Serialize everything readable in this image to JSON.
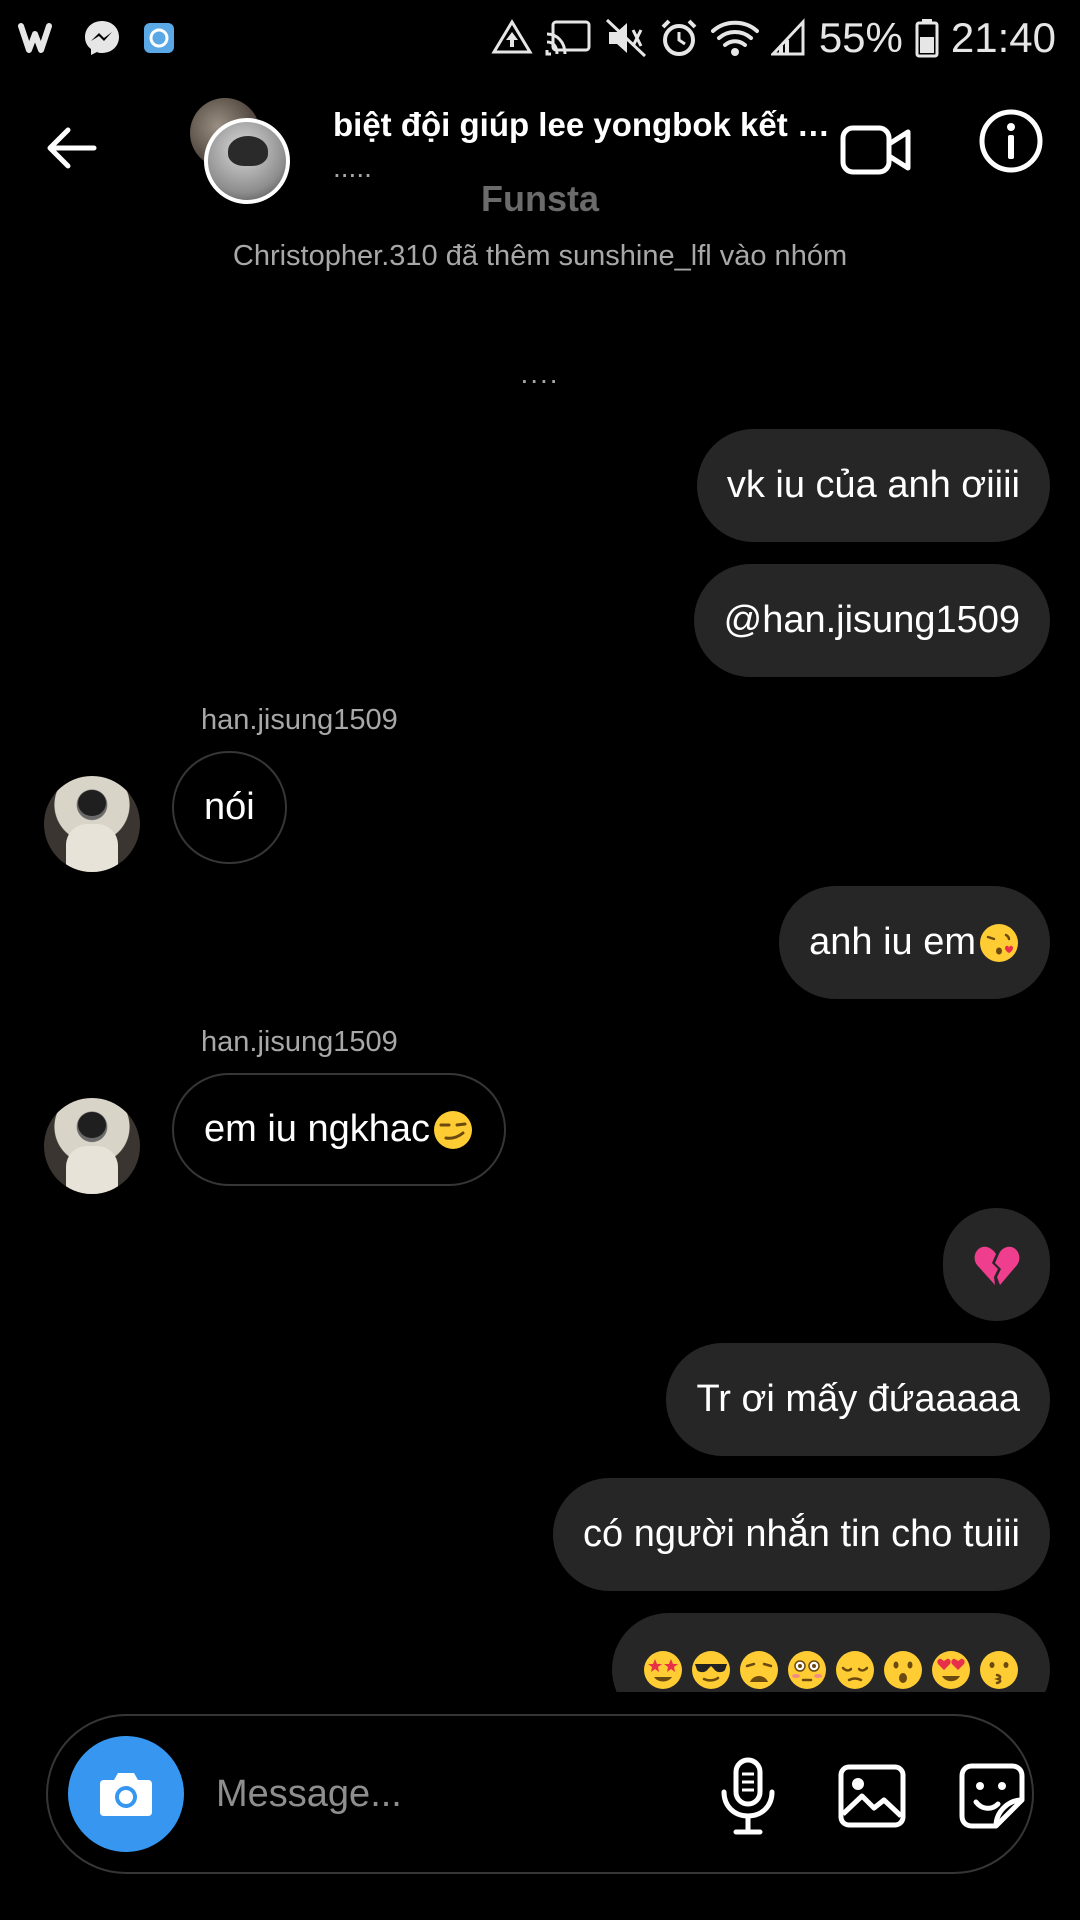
{
  "status_bar": {
    "battery_percent": "55%",
    "time": "21:40"
  },
  "header": {
    "title": "biệt đội giúp lee yongbok kết …",
    "subtitle": "....."
  },
  "banner": "Funsta",
  "system_message": "Christopher.310 đã thêm sunshine_lfl vào nhóm",
  "dots_message": "....",
  "messages": [
    {
      "text": "vk iu của anh ơiiii"
    },
    {
      "text": "@han.jisung1509"
    },
    {
      "sender": "han.jisung1509",
      "text": "nói"
    },
    {
      "text": "anh iu em"
    },
    {
      "sender": "han.jisung1509",
      "text": "em iu ngkhac"
    },
    {
      "emoji": "broken-heart"
    },
    {
      "text": "Tr ơi mấy đứaaaaa"
    },
    {
      "text": "có người nhắn tin cho tuiii"
    },
    {
      "emojis": [
        "star-struck",
        "sunglasses",
        "weary",
        "flushed",
        "pensive",
        "astonished",
        "heart-eyes",
        "kissing"
      ]
    }
  ],
  "composer": {
    "placeholder": "Message..."
  },
  "colors": {
    "background": "#000000",
    "sent_bubble": "#262626",
    "accent_blue": "#3797f0",
    "secondary_text": "#a8a8a8"
  },
  "icons": {
    "back": "arrow-left-icon",
    "video": "video-call-icon",
    "info": "info-icon",
    "camera": "camera-icon",
    "mic": "microphone-icon",
    "gallery": "gallery-icon",
    "sticker": "sticker-icon"
  }
}
